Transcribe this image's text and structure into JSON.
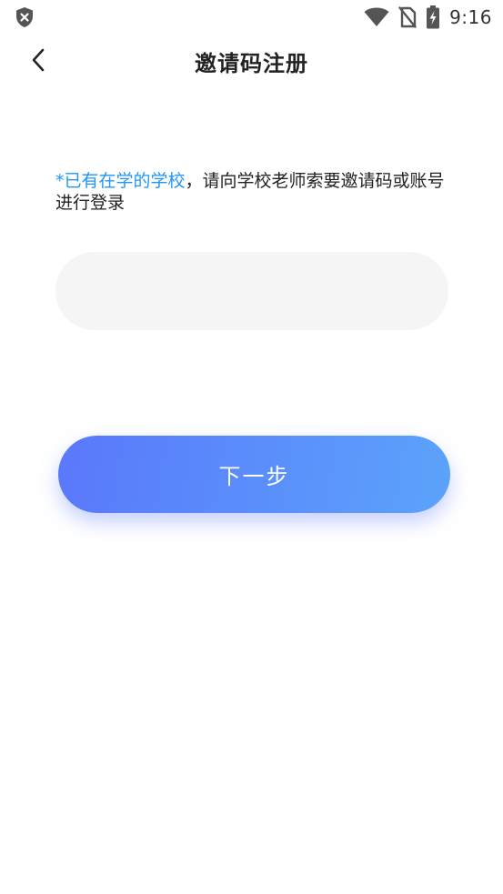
{
  "status_bar": {
    "time": "9:16",
    "left_icon": "shield-x-icon",
    "right_icons": [
      "wifi-icon",
      "no-sim-icon",
      "battery-charging-icon"
    ]
  },
  "nav": {
    "back_icon": "chevron-left-icon",
    "title": "邀请码注册"
  },
  "hint": {
    "highlight": "*已有在学的学校",
    "rest": "，请向学校老师索要邀请码或账号进行登录"
  },
  "invite_input": {
    "value": "",
    "placeholder": ""
  },
  "next_button": {
    "label": "下一步"
  },
  "colors": {
    "accent": "#2196f3",
    "button_gradient_start": "#5a78fb",
    "button_gradient_end": "#5ba3fb",
    "input_background": "#f5f5f5"
  }
}
